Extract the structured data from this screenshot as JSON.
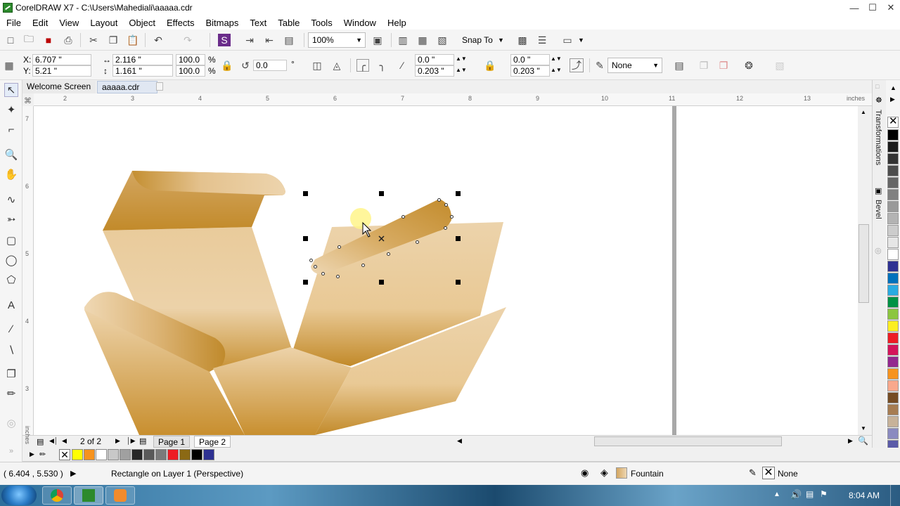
{
  "window": {
    "title": "CorelDRAW X7 - C:\\Users\\Mahediali\\aaaaa.cdr",
    "minimize": "—",
    "maximize": "☐",
    "close": "✕"
  },
  "menu": [
    "File",
    "Edit",
    "View",
    "Layout",
    "Object",
    "Effects",
    "Bitmaps",
    "Text",
    "Table",
    "Tools",
    "Window",
    "Help"
  ],
  "std_toolbar": {
    "zoom": "100%",
    "snap_to": "Snap To"
  },
  "prop_bar": {
    "x_label": "X:",
    "x_value": "6.707 \"",
    "y_label": "Y:",
    "y_value": "5.21 \"",
    "width_value": "2.116 \"",
    "height_value": "1.161 \"",
    "scale_w": "100.0",
    "scale_h": "100.0",
    "percent": "%",
    "rotation": "0.0",
    "degree": "°",
    "corner_a1": "0.0 \"",
    "corner_a2": "0.203 \"",
    "corner_b1": "0.0 \"",
    "corner_b2": "0.203 \"",
    "outline": "None"
  },
  "doc_tabs": [
    "Welcome Screen",
    "aaaaa.cdr"
  ],
  "ruler": {
    "units": "inches",
    "h_ticks": [
      "2",
      "3",
      "4",
      "5",
      "6",
      "7",
      "8",
      "9",
      "10",
      "11",
      "12",
      "13"
    ],
    "v_ticks": [
      "7",
      "6",
      "5",
      "4",
      "3"
    ]
  },
  "page_nav": {
    "counter": "2 of 2",
    "pages": [
      "Page 1",
      "Page 2"
    ],
    "units": "inches"
  },
  "docker": {
    "panels": [
      "Transformations",
      "Bevel"
    ]
  },
  "palette_colors": [
    "#000000",
    "#1a1a1a",
    "#333333",
    "#4d4d4d",
    "#666666",
    "#808080",
    "#999999",
    "#b3b3b3",
    "#cccccc",
    "#e6e6e6",
    "#ffffff",
    "#2e3192",
    "#0071bc",
    "#29abe2",
    "#009245",
    "#8cc63f",
    "#fcee21",
    "#ed1c24",
    "#d4145a",
    "#93278f",
    "#f7931e",
    "#f9a88c",
    "#754c24",
    "#a67c52",
    "#c7b299",
    "#8a8ac0",
    "#5b5ba8",
    "#a0a0d0"
  ],
  "doc_palette_colors": [
    "#ffff00",
    "#f7931e",
    "#ffffff",
    "#c8c8c8",
    "#a0a0a0",
    "#262626",
    "#595959",
    "#7a7a7a",
    "#ed1c24",
    "#8b6914",
    "#000000",
    "#2e3192"
  ],
  "status": {
    "coords": "( 6.404 , 5.530 )",
    "object_info": "Rectangle on Layer 1  (Perspective)",
    "fill": "Fountain",
    "outline": "None"
  },
  "taskbar": {
    "time": "8:04 AM"
  }
}
